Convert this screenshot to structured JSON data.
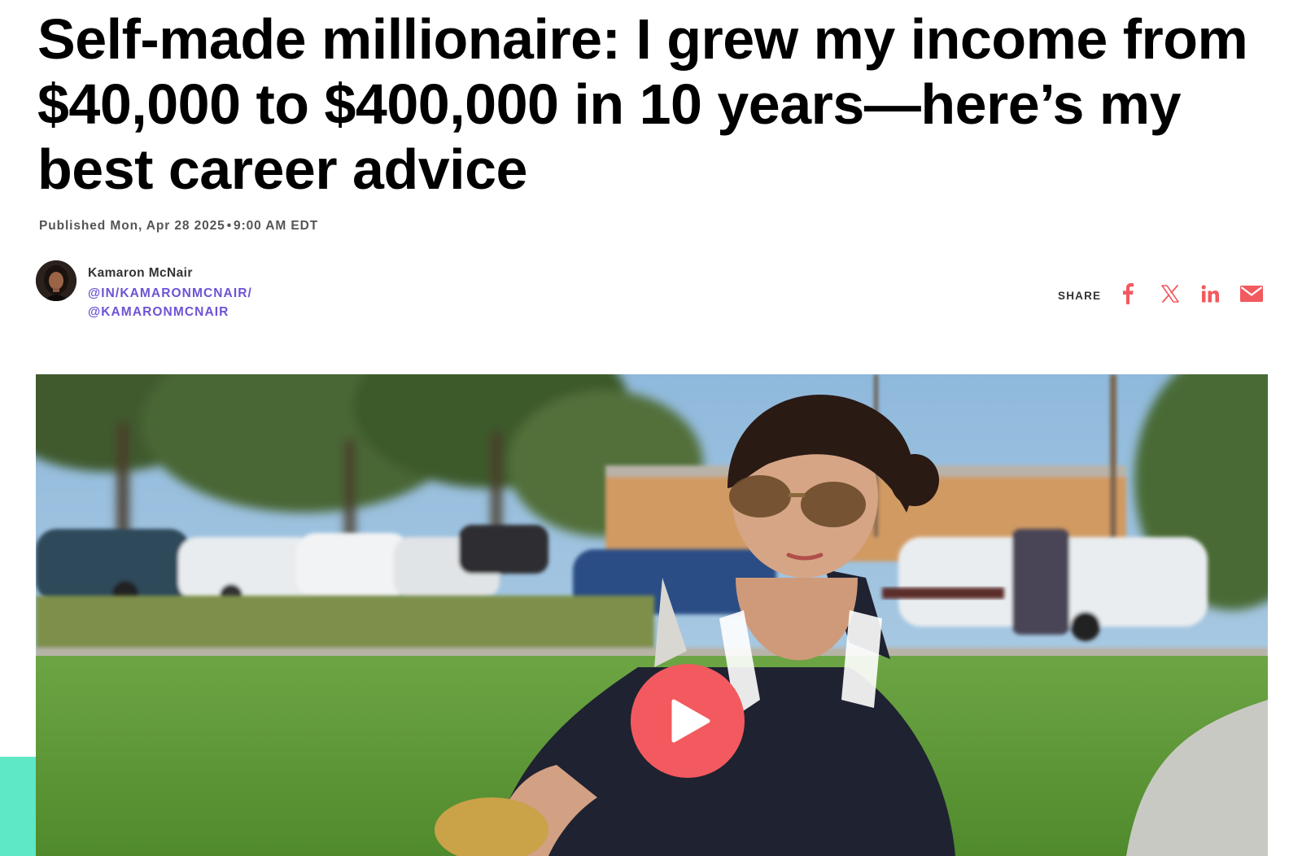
{
  "article": {
    "headline": "Self-made millionaire: I grew my income from $40,000 to $400,000 in 10 years—here’s my best career advice",
    "published_prefix": "Published",
    "published_date": "Mon, Apr 28 2025",
    "published_separator": "•",
    "published_time": "9:00 AM EDT"
  },
  "author": {
    "name": "Kamaron McNair",
    "linkedin_handle": "@IN/KAMARONMCNAIR/",
    "twitter_handle": "@KAMARONMCNAIR"
  },
  "share": {
    "label": "SHARE",
    "icons": [
      "facebook-icon",
      "x-icon",
      "linkedin-icon",
      "email-icon"
    ]
  },
  "media": {
    "play_icon": "play-icon"
  },
  "colors": {
    "share_icon": "#f25a5f",
    "author_link": "#6e53d5",
    "play_button": "#f25a5f",
    "accent_bar": "#5ee8c6"
  }
}
